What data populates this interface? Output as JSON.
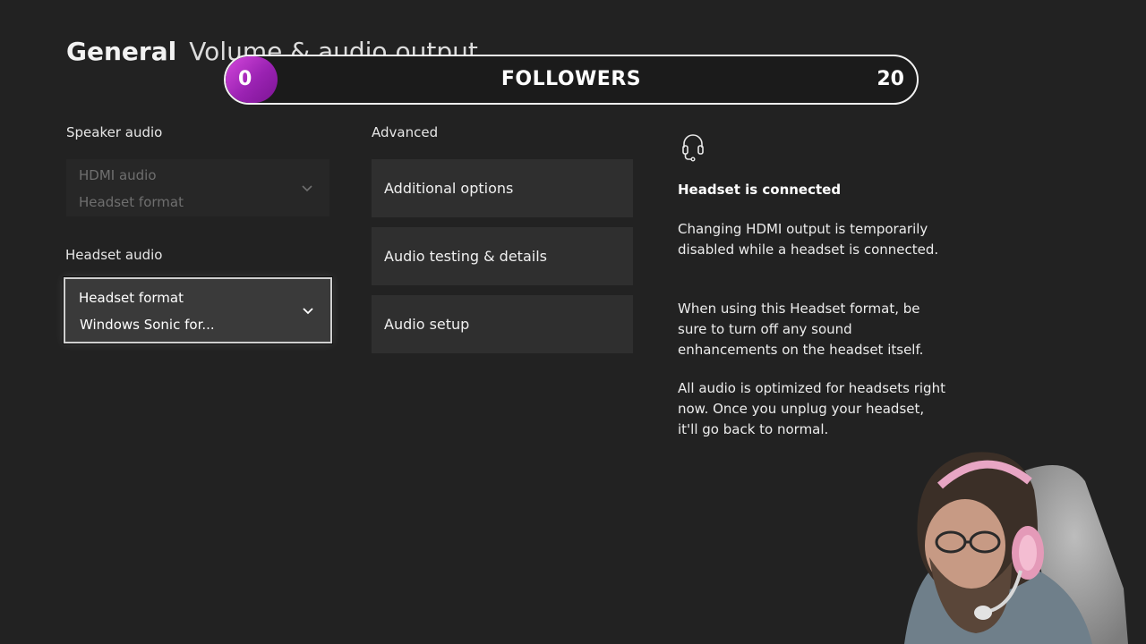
{
  "header": {
    "crumb_main": "General",
    "crumb_sub": "Volume & audio output"
  },
  "followers_overlay": {
    "min": "0",
    "label": "FOLLOWERS",
    "max": "20",
    "progress_fraction": 0,
    "fill_color": "#a32bbd"
  },
  "speaker_audio": {
    "label": "Speaker audio",
    "dropdown": {
      "line1": "HDMI audio",
      "line2": "Headset format",
      "disabled": true
    }
  },
  "headset_audio": {
    "label": "Headset audio",
    "dropdown": {
      "line1": "Headset format",
      "line2": "Windows Sonic for...",
      "focused": true
    }
  },
  "advanced": {
    "label": "Advanced",
    "options": [
      {
        "label": "Additional options"
      },
      {
        "label": "Audio testing & details"
      },
      {
        "label": "Audio setup"
      }
    ]
  },
  "info_panel": {
    "icon": "headset-icon",
    "heading": "Headset is connected",
    "paragraphs": [
      "Changing HDMI output is temporarily disabled while a headset is connected.",
      "When using this Headset format, be sure to turn off any sound enhancements on the headset itself.",
      "All audio is optimized for headsets right now. Once you unplug your headset, it'll go back to normal."
    ]
  },
  "colors": {
    "background": "#222222",
    "accent_purple": "#a32bbd",
    "focus_border": "#cfcfcf"
  }
}
